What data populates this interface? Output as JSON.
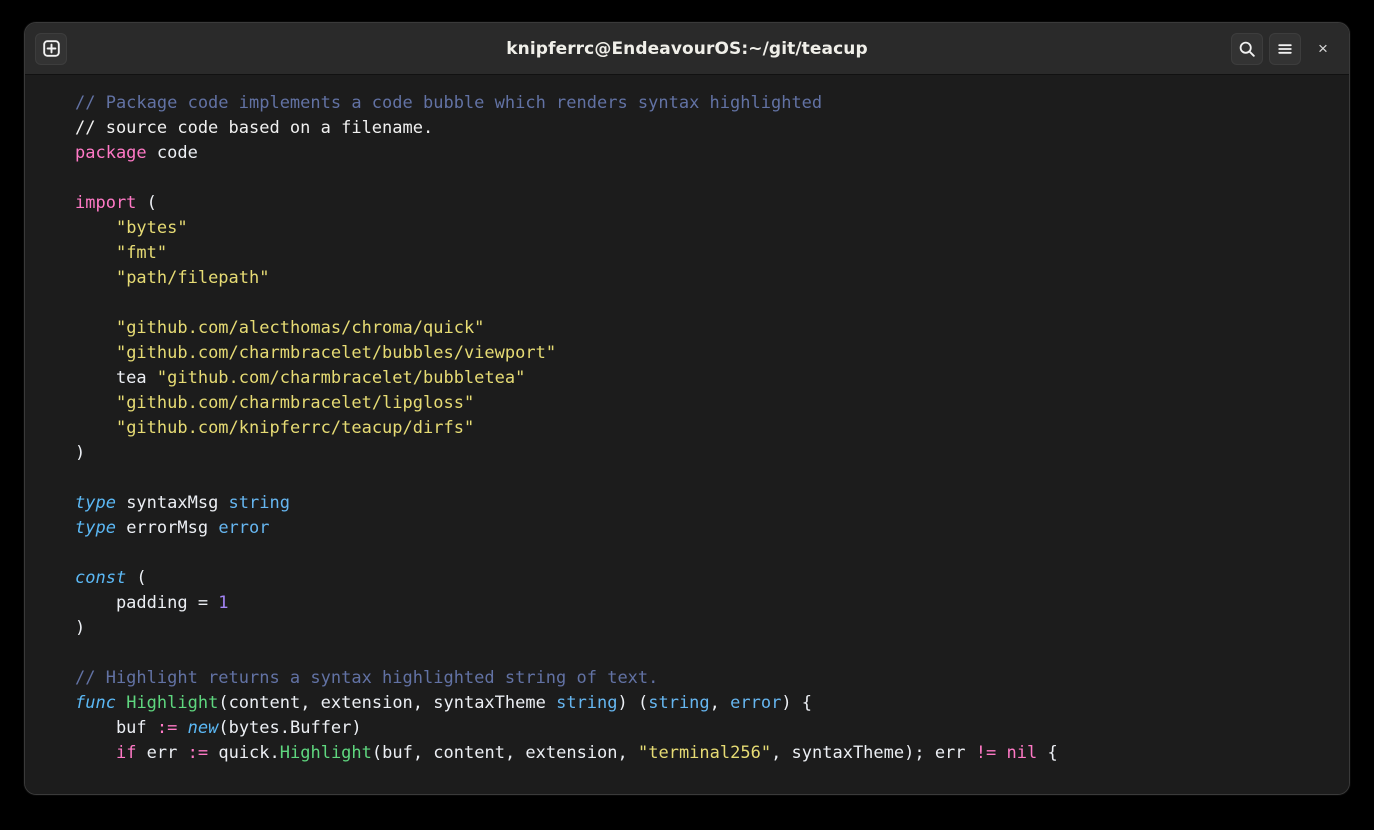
{
  "window": {
    "title": "knipferrc@EndeavourOS:~/git/teacup",
    "background_color": "#1c1c1c",
    "titlebar_color": "#2a2a2a",
    "controls": {
      "new_tab_label": "New Tab",
      "search_label": "Search",
      "menu_label": "Menu",
      "close_label": "×"
    }
  },
  "terminal": {
    "lines": [
      [
        {
          "text": "// Package code implements a code bubble which renders syntax highlighted",
          "cls": "t-cmt-dim"
        }
      ],
      [
        {
          "text": "// source code based on a filename.",
          "cls": "t-cmt-plain"
        }
      ],
      [
        {
          "text": "package",
          "cls": "t-kw"
        },
        {
          "text": " code",
          "cls": "t-plain"
        }
      ],
      [],
      [
        {
          "text": "import",
          "cls": "t-kw"
        },
        {
          "text": " (",
          "cls": "t-punct"
        }
      ],
      [
        {
          "text": "    ",
          "cls": "t-plain"
        },
        {
          "text": "\"bytes\"",
          "cls": "t-str"
        }
      ],
      [
        {
          "text": "    ",
          "cls": "t-plain"
        },
        {
          "text": "\"fmt\"",
          "cls": "t-str"
        }
      ],
      [
        {
          "text": "    ",
          "cls": "t-plain"
        },
        {
          "text": "\"path/filepath\"",
          "cls": "t-str"
        }
      ],
      [],
      [
        {
          "text": "    ",
          "cls": "t-plain"
        },
        {
          "text": "\"github.com/alecthomas/chroma/quick\"",
          "cls": "t-str"
        }
      ],
      [
        {
          "text": "    ",
          "cls": "t-plain"
        },
        {
          "text": "\"github.com/charmbracelet/bubbles/viewport\"",
          "cls": "t-str"
        }
      ],
      [
        {
          "text": "    tea ",
          "cls": "t-plain"
        },
        {
          "text": "\"github.com/charmbracelet/bubbletea\"",
          "cls": "t-str"
        }
      ],
      [
        {
          "text": "    ",
          "cls": "t-plain"
        },
        {
          "text": "\"github.com/charmbracelet/lipgloss\"",
          "cls": "t-str"
        }
      ],
      [
        {
          "text": "    ",
          "cls": "t-plain"
        },
        {
          "text": "\"github.com/knipferrc/teacup/dirfs\"",
          "cls": "t-str"
        }
      ],
      [
        {
          "text": ")",
          "cls": "t-punct"
        }
      ],
      [],
      [
        {
          "text": "type",
          "cls": "t-kw-it"
        },
        {
          "text": " syntaxMsg ",
          "cls": "t-plain"
        },
        {
          "text": "string",
          "cls": "t-type"
        }
      ],
      [
        {
          "text": "type",
          "cls": "t-kw-it"
        },
        {
          "text": " errorMsg ",
          "cls": "t-plain"
        },
        {
          "text": "error",
          "cls": "t-type"
        }
      ],
      [],
      [
        {
          "text": "const",
          "cls": "t-kw-it"
        },
        {
          "text": " (",
          "cls": "t-punct"
        }
      ],
      [
        {
          "text": "    padding = ",
          "cls": "t-plain"
        },
        {
          "text": "1",
          "cls": "t-num"
        }
      ],
      [
        {
          "text": ")",
          "cls": "t-punct"
        }
      ],
      [],
      [
        {
          "text": "// Highlight returns a syntax highlighted string of text.",
          "cls": "t-cmt-dim"
        }
      ],
      [
        {
          "text": "func",
          "cls": "t-kw-it"
        },
        {
          "text": " ",
          "cls": "t-plain"
        },
        {
          "text": "Highlight",
          "cls": "t-fn"
        },
        {
          "text": "(content, extension, syntaxTheme ",
          "cls": "t-plain"
        },
        {
          "text": "string",
          "cls": "t-type"
        },
        {
          "text": ") (",
          "cls": "t-plain"
        },
        {
          "text": "string",
          "cls": "t-type"
        },
        {
          "text": ", ",
          "cls": "t-plain"
        },
        {
          "text": "error",
          "cls": "t-type"
        },
        {
          "text": ") {",
          "cls": "t-plain"
        }
      ],
      [
        {
          "text": "    buf ",
          "cls": "t-plain"
        },
        {
          "text": ":=",
          "cls": "t-kw"
        },
        {
          "text": " ",
          "cls": "t-plain"
        },
        {
          "text": "new",
          "cls": "t-kw-it"
        },
        {
          "text": "(bytes.Buffer)",
          "cls": "t-plain"
        }
      ],
      [
        {
          "text": "    ",
          "cls": "t-plain"
        },
        {
          "text": "if",
          "cls": "t-kw"
        },
        {
          "text": " err ",
          "cls": "t-plain"
        },
        {
          "text": ":=",
          "cls": "t-kw"
        },
        {
          "text": " quick.",
          "cls": "t-plain"
        },
        {
          "text": "Highlight",
          "cls": "t-fn"
        },
        {
          "text": "(buf, content, extension, ",
          "cls": "t-plain"
        },
        {
          "text": "\"terminal256\"",
          "cls": "t-str"
        },
        {
          "text": ", syntaxTheme); err ",
          "cls": "t-plain"
        },
        {
          "text": "!=",
          "cls": "t-kw"
        },
        {
          "text": " ",
          "cls": "t-plain"
        },
        {
          "text": "nil",
          "cls": "t-kw"
        },
        {
          "text": " {",
          "cls": "t-plain"
        }
      ]
    ]
  },
  "colors": {
    "comment_dim": "#6272a4",
    "comment_plain": "#f0f0f0",
    "keyword": "#ff79c6",
    "keyword_italic": "#5bb8f5",
    "type": "#66b6f0",
    "string": "#e6db74",
    "number": "#a384f5",
    "function": "#5fd77f",
    "foreground": "#eceff4",
    "background": "#1c1c1c"
  }
}
